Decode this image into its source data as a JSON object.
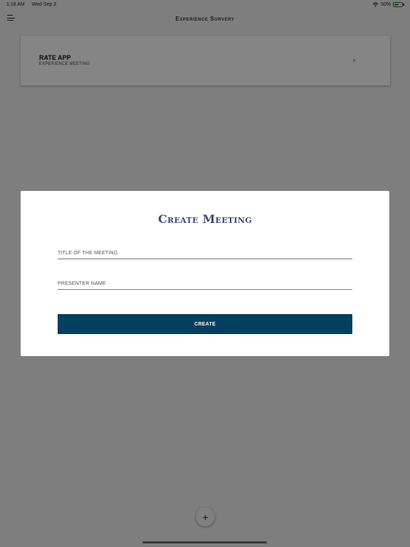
{
  "status": {
    "time": "1:18 AM",
    "date": "Wed Sep 2",
    "battery": "50%"
  },
  "nav": {
    "title": "Experience Survery"
  },
  "card": {
    "title": "RATE APP",
    "subtitle": "EXPERIENCE MEETING"
  },
  "modal": {
    "title": "Create Meeting",
    "meeting_title_placeholder": "TITLE OF THE MEETING",
    "meeting_title_value": "",
    "presenter_placeholder": "PRESENTER NAME",
    "presenter_value": "",
    "create_label": "CREATE"
  },
  "fab": {
    "label": "+"
  },
  "colors": {
    "accent": "#033f5e",
    "title": "#3d4a7a",
    "battery": "#3bb34a"
  },
  "icons": [
    "menu-icon",
    "wifi-icon",
    "battery-icon",
    "chevron-right-icon",
    "plus-icon"
  ]
}
